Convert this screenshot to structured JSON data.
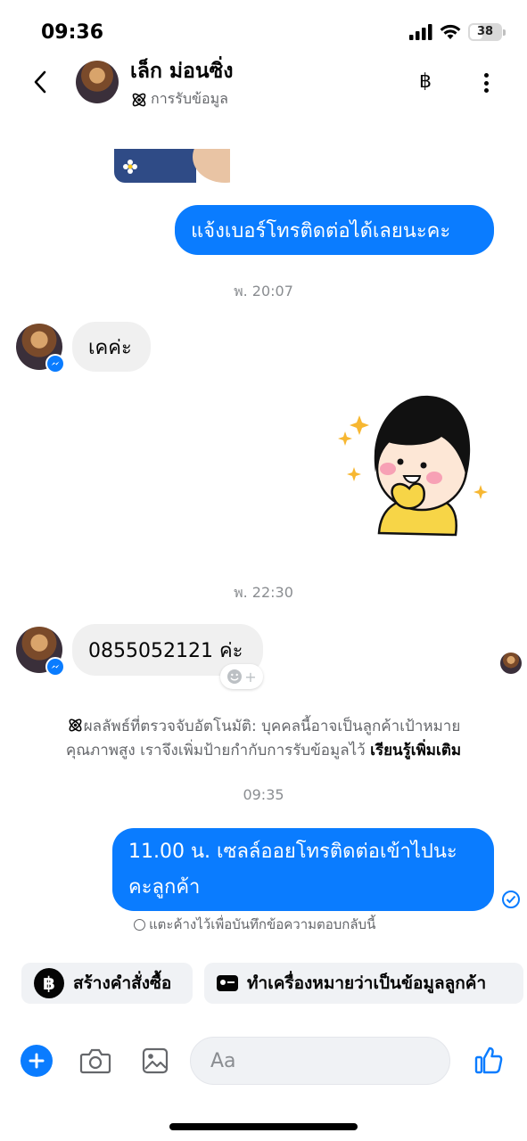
{
  "status_bar": {
    "time": "09:36",
    "battery": "38"
  },
  "header": {
    "name": "เล็ก ม่อนซิ่ง",
    "subtitle": "การรับข้อมูล",
    "currency_symbol": "฿"
  },
  "messages": [
    {
      "type": "sent",
      "text": "แจ้งเบอร์โทรติดต่อได้เลยนะคะ"
    },
    {
      "type": "timestamp",
      "text": "พ. 20:07"
    },
    {
      "type": "received",
      "text": "เคค่ะ"
    },
    {
      "type": "timestamp",
      "text": "พ. 22:30"
    },
    {
      "type": "received",
      "text": "0855052121 ค่ะ"
    },
    {
      "type": "timestamp",
      "text": "09:35"
    },
    {
      "type": "sent",
      "line1": "11.00 น. เซลล์ออยโทรติดต่อเข้าไปนะ",
      "line2": "คะลูกค้า"
    }
  ],
  "system_notice": {
    "line1": "ผลลัพธ์ที่ตรวจจับอัตโนมัติ: บุคคลนี้อาจเป็นลูกค้าเป้าหมาย",
    "line2": "คุณภาพสูง เราจึงเพิ่มป้ายกำกับการรับข้อมูลไว้ ",
    "link": "เรียนรู้เพิ่มเติม"
  },
  "reply_hint": "แตะค้างไว้เพื่อบันทึกข้อความตอบกลับนี้",
  "quick_actions": {
    "create_order": "สร้างคำสั่งซื้อ",
    "mark_lead": "ทำเครื่องหมายว่าเป็นข้อมูลลูกค้า"
  },
  "composer": {
    "placeholder": "Aa"
  },
  "colors": {
    "accent": "#0a7cff",
    "bubble_in": "#f0f0f0",
    "meta_text": "#8a8d91"
  },
  "icons": [
    "back-icon",
    "baht-icon",
    "more-icon",
    "lead-icon",
    "messenger-icon",
    "emoji-add-icon",
    "sent-check-icon",
    "plus-icon",
    "camera-icon",
    "gallery-icon",
    "emoji-icon",
    "thumbs-up-icon"
  ]
}
